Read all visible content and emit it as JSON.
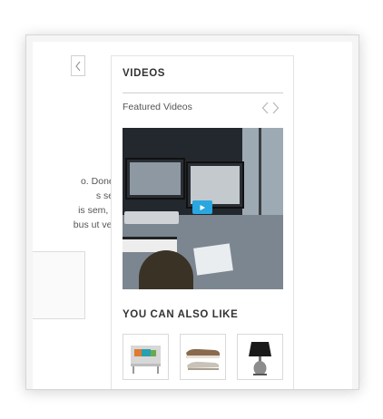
{
  "sidebar": {
    "title": "VIDEOS",
    "featured_label": "Featured Videos"
  },
  "body_text": {
    "lines": [
      "o. Donec",
      "s sed",
      "is sem, et",
      "bus ut velit"
    ]
  },
  "video": {
    "play_icon": "play-icon"
  },
  "also_like": {
    "title": "YOU CAN ALSO LIKE",
    "products": [
      {
        "name": "chair-thumbnail"
      },
      {
        "name": "shoes-thumbnail"
      },
      {
        "name": "lamp-thumbnail"
      }
    ]
  },
  "colors": {
    "accent_play": "#2aa6e0",
    "border": "#e3e3e3"
  }
}
